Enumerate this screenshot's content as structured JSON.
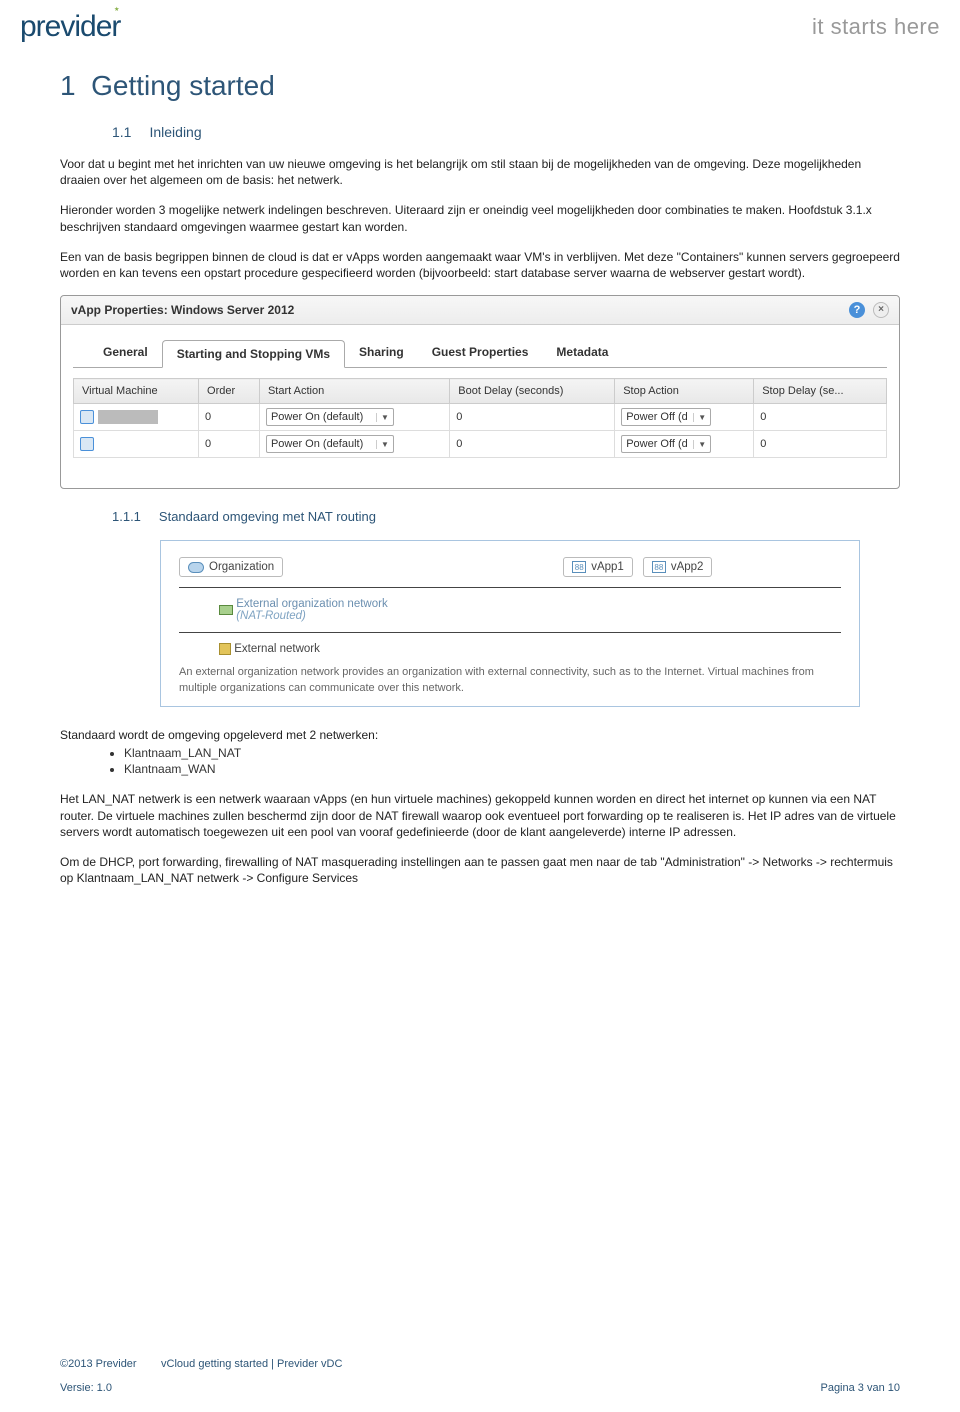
{
  "header": {
    "logo": "previder",
    "tagline": "it starts here"
  },
  "headings": {
    "h1_num": "1",
    "h1": "Getting started",
    "h2_num": "1.1",
    "h2": "Inleiding",
    "h3_num": "1.1.1",
    "h3": "Standaard omgeving met NAT routing"
  },
  "paragraphs": {
    "p1": "Voor dat u begint met het inrichten van uw nieuwe omgeving is het belangrijk om stil staan bij de mogelijkheden van de omgeving. Deze mogelijkheden draaien over het algemeen om de basis: het netwerk.",
    "p2": "Hieronder worden 3 mogelijke netwerk indelingen beschreven. Uiteraard zijn er oneindig veel mogelijkheden door combinaties te maken. Hoofdstuk 3.1.x beschrijven standaard omgevingen waarmee gestart kan worden.",
    "p3": "Een van de basis begrippen binnen de cloud is dat er vApps worden aangemaakt waar VM's in verblijven. Met deze \"Containers\" kunnen servers gegroepeerd worden en kan tevens een opstart procedure gespecifieerd worden (bijvoorbeeld: start database server waarna de webserver gestart wordt).",
    "p4_intro": "Standaard wordt de omgeving opgeleverd met 2 netwerken:",
    "p5": "Het LAN_NAT netwerk is een netwerk waaraan vApps (en hun virtuele machines) gekoppeld kunnen worden en direct het internet op kunnen via een NAT router. De virtuele machines zullen beschermd zijn door de NAT firewall waarop ook eventueel port forwarding op te realiseren is. Het IP adres van de virtuele servers wordt automatisch toegewezen uit een pool van vooraf gedefinieerde (door de klant aangeleverde) interne IP adressen.",
    "p6": "Om de DHCP, port forwarding, firewalling of NAT masquerading instellingen aan te passen gaat men naar de tab \"Administration\" -> Networks -> rechtermuis op Klantnaam_LAN_NAT netwerk -> Configure Services"
  },
  "bullets": [
    "Klantnaam_LAN_NAT",
    "Klantnaam_WAN"
  ],
  "dialog": {
    "title": "vApp Properties: Windows Server 2012",
    "tabs": [
      "General",
      "Starting and Stopping VMs",
      "Sharing",
      "Guest Properties",
      "Metadata"
    ],
    "active_tab": 1,
    "columns": [
      "Virtual Machine",
      "Order",
      "Start Action",
      "Boot Delay (seconds)",
      "Stop Action",
      "Stop Delay (se..."
    ],
    "rows": [
      {
        "order": "0",
        "start": "Power On (default)",
        "boot": "0",
        "stop": "Power Off (d",
        "stopdelay": "0"
      },
      {
        "order": "0",
        "start": "Power On (default)",
        "boot": "0",
        "stop": "Power Off (d",
        "stopdelay": "0"
      }
    ]
  },
  "diagram": {
    "org": "Organization",
    "vapp1": "vApp1",
    "vapp2": "vApp2",
    "extorg": "External organization network",
    "extorg_sub": "(NAT-Routed)",
    "extnet": "External network",
    "caption": "An external organization network provides an organization with external connectivity, such as to the Internet. Virtual machines from multiple organizations can communicate over this network."
  },
  "footer": {
    "copyright": "©2013 Previder",
    "version": "Versie: 1.0",
    "center": "vCloud getting started | Previder vDC",
    "page": "Pagina 3 van 10"
  }
}
